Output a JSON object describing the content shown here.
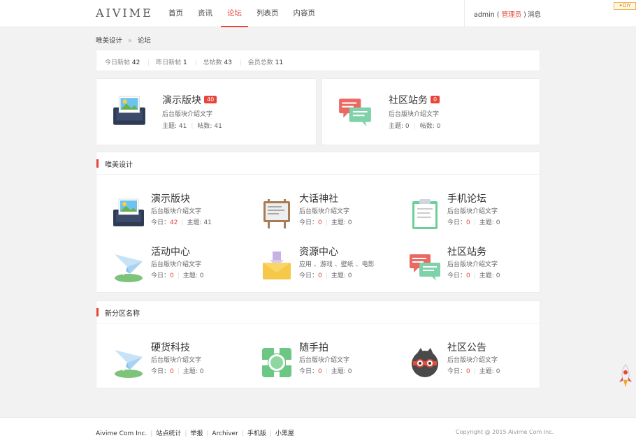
{
  "header": {
    "logo": "AIVIME",
    "nav": [
      {
        "label": "首页"
      },
      {
        "label": "资讯"
      },
      {
        "label": "论坛"
      },
      {
        "label": "列表页"
      },
      {
        "label": "内容页"
      }
    ],
    "active_nav": "论坛",
    "user": "admin",
    "role_open": "(",
    "role": "管理员",
    "role_close": ")",
    "messages": "消息",
    "diy": "✦DIY"
  },
  "breadcrumb": {
    "home": "唯美设计",
    "sep": "»",
    "current": "论坛"
  },
  "stats": {
    "today_label": "今日新帖",
    "today": "42",
    "yesterday_label": "昨日新帖",
    "yesterday": "1",
    "posts_label": "总帖数",
    "posts": "43",
    "members_label": "会员总数",
    "members": "11"
  },
  "top_cards": [
    {
      "title": "演示版块",
      "badge": "40",
      "desc": "后台版块介绍文字",
      "topics_label": "主题:",
      "topics": "41",
      "posts_label": "帖数:",
      "posts": "41",
      "icon": "photo-tablet-icon"
    },
    {
      "title": "社区站务",
      "badge": "0",
      "desc": "后台版块介绍文字",
      "topics_label": "主题:",
      "topics": "0",
      "posts_label": "帖数:",
      "posts": "0",
      "icon": "chat-bubbles-icon"
    }
  ],
  "sections": [
    {
      "title": "唯美设计",
      "forums": [
        {
          "name": "演示版块",
          "desc": "后台版块介绍文字",
          "today_label": "今日：",
          "today": "42",
          "topics_label": "主题:",
          "topics": "41",
          "icon": "photo-tablet-icon"
        },
        {
          "name": "大话神社",
          "desc": "后台版块介绍文字",
          "today_label": "今日：",
          "today": "0",
          "topics_label": "主题:",
          "topics": "0",
          "icon": "easel-board-icon"
        },
        {
          "name": "手机论坛",
          "desc": "后台版块介绍文字",
          "today_label": "今日：",
          "today": "0",
          "topics_label": "主题:",
          "topics": "0",
          "icon": "clipboard-icon"
        },
        {
          "name": "活动中心",
          "desc": "后台版块介绍文字",
          "today_label": "今日：",
          "today": "0",
          "topics_label": "主题:",
          "topics": "0",
          "icon": "paper-plane-icon"
        },
        {
          "name": "资源中心",
          "desc": "应用 、游戏 、壁纸 、电影",
          "today_label": "今日：",
          "today": "0",
          "topics_label": "主题:",
          "topics": "0",
          "icon": "envelope-icon"
        },
        {
          "name": "社区站务",
          "desc": "后台版块介绍文字",
          "today_label": "今日：",
          "today": "0",
          "topics_label": "主题:",
          "topics": "0",
          "icon": "chat-bubbles-icon"
        }
      ]
    },
    {
      "title": "新分区名称",
      "forums": [
        {
          "name": "硬货科技",
          "desc": "后台版块介绍文字",
          "today_label": "今日：",
          "today": "0",
          "topics_label": "主题:",
          "topics": "0",
          "icon": "paper-plane-icon"
        },
        {
          "name": "随手拍",
          "desc": "后台版块介绍文字",
          "today_label": "今日：",
          "today": "0",
          "topics_label": "主题:",
          "topics": "0",
          "icon": "camera-lens-icon"
        },
        {
          "name": "社区公告",
          "desc": "后台版块介绍文字",
          "today_label": "今日：",
          "today": "0",
          "topics_label": "主题:",
          "topics": "0",
          "icon": "ninja-face-icon"
        }
      ]
    }
  ],
  "footer": {
    "links": [
      "Aivime Com Inc.",
      "站点统计",
      "举报",
      "Archiver",
      "手机版",
      "小黑屋"
    ],
    "copyright": "Copyright @ 2015 Aivime Com Inc."
  },
  "colors": {
    "accent": "#e8443a",
    "background": "#f2f2f2"
  }
}
